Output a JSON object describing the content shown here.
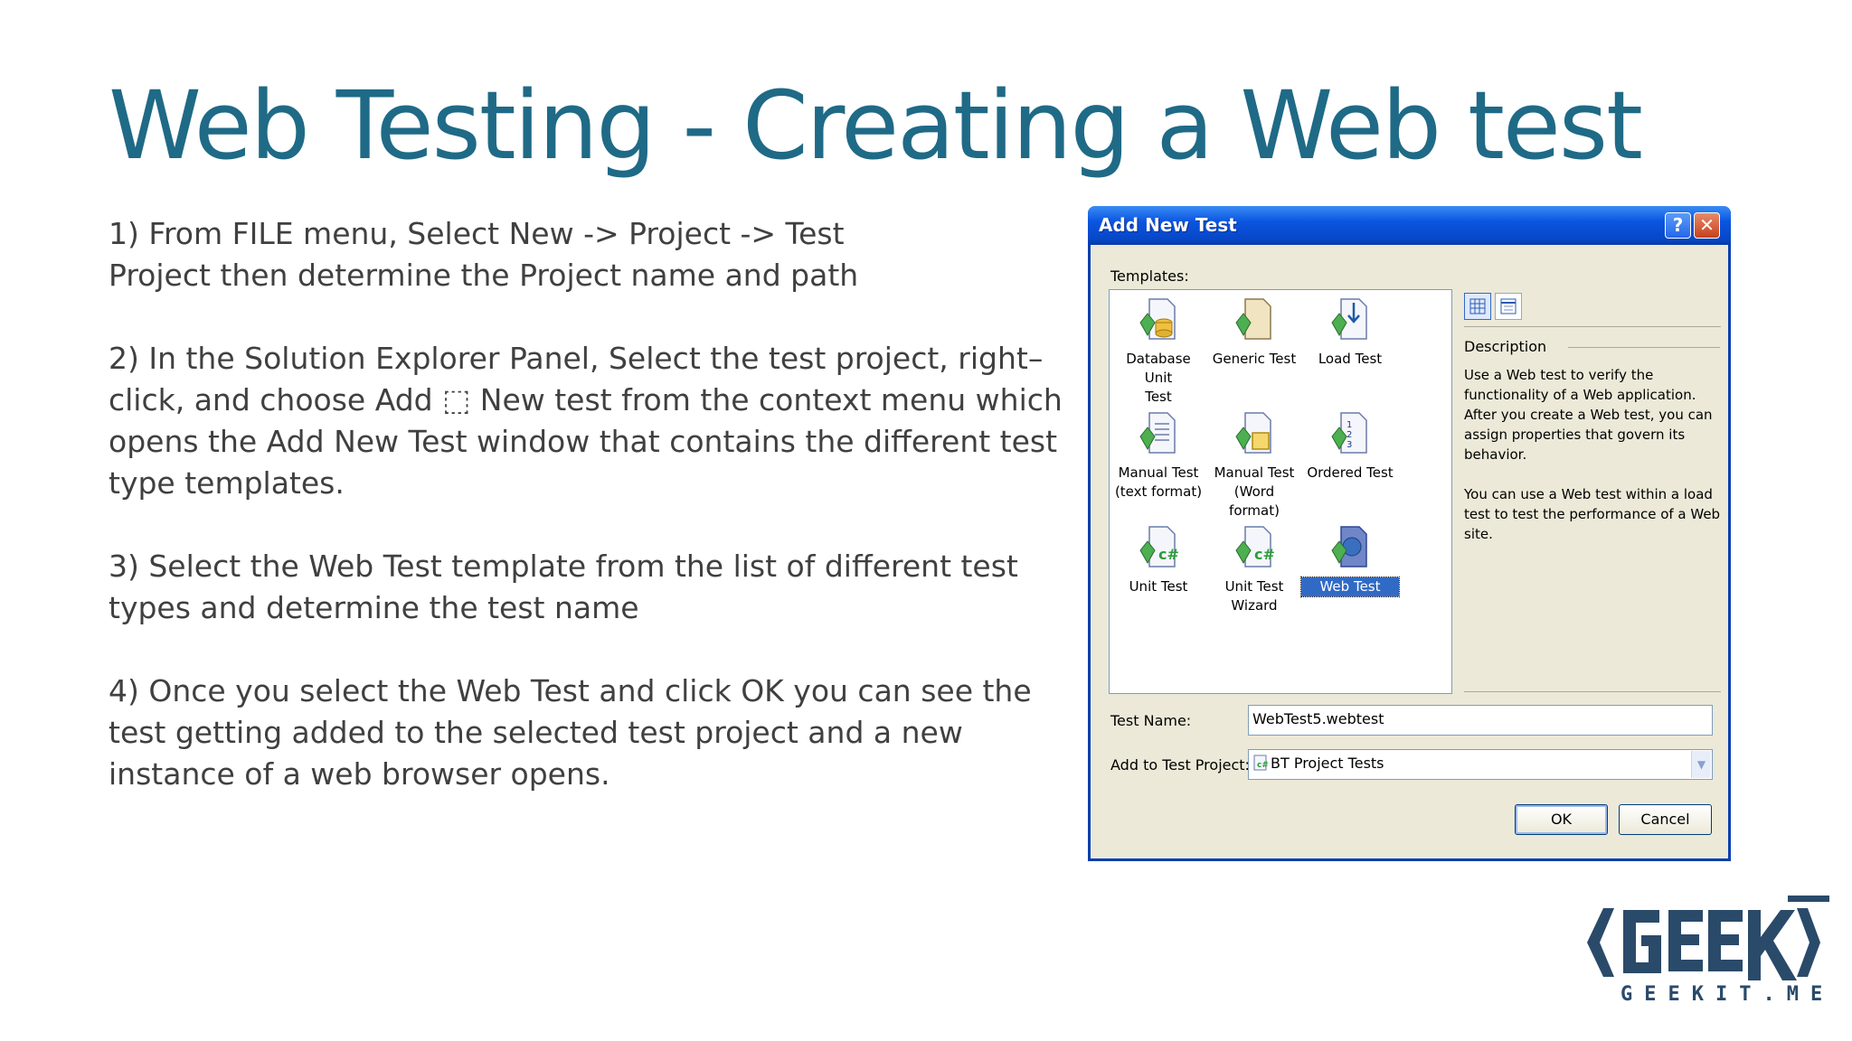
{
  "slide": {
    "title": "Web Testing - Creating a Web test",
    "paragraphs": [
      "1) From FILE menu, Select New -> Project -> Test\nProject then determine the Project name and path",
      "2) In the Solution Explorer Panel, Select the test project, right–click, and choose Add ⬚ New test from the context menu which opens the Add New Test window that contains the different test type templates.",
      "3) Select the Web Test template from the list of different test types and determine the test name",
      "4) Once you select the Web Test and click OK you can see the test getting added to the selected test project and a new instance of a web browser opens."
    ]
  },
  "dialog": {
    "title": "Add New Test",
    "help_label": "?",
    "close_label": "✕",
    "templates_label": "Templates:",
    "templates": [
      {
        "label": "Database Unit\nTest",
        "icon": "database-unit-test-icon"
      },
      {
        "label": "Generic Test",
        "icon": "generic-test-icon"
      },
      {
        "label": "Load Test",
        "icon": "load-test-icon"
      },
      {
        "label": "Manual Test\n(text format)",
        "icon": "manual-test-text-icon"
      },
      {
        "label": "Manual Test\n(Word format)",
        "icon": "manual-test-word-icon"
      },
      {
        "label": "Ordered Test",
        "icon": "ordered-test-icon"
      },
      {
        "label": "Unit Test",
        "icon": "unit-test-icon"
      },
      {
        "label": "Unit Test\nWizard",
        "icon": "unit-test-wizard-icon"
      },
      {
        "label": "Web Test",
        "icon": "web-test-icon",
        "selected": true
      }
    ],
    "description_label": "Description",
    "description": [
      "Use a Web test to verify the functionality of a Web application. After you create a Web test, you can assign properties that govern its behavior.",
      "You can use a Web test within a load test to test the performance of a Web site."
    ],
    "test_name_label": "Test Name:",
    "test_name_value": "WebTest5.webtest",
    "add_to_project_label": "Add to Test Project:",
    "add_to_project_value": "BT Project Tests",
    "ok_label": "OK",
    "cancel_label": "Cancel"
  },
  "logo": {
    "text": "GEEKIT",
    "sub": "GEEKIT.ME",
    "color": "#2a4a6a"
  },
  "colors": {
    "title": "#1f6a86",
    "body_text": "#404040",
    "dialog_titlebar": "#0a55e0",
    "dialog_face": "#ece9d8",
    "selection": "#316ac5"
  }
}
